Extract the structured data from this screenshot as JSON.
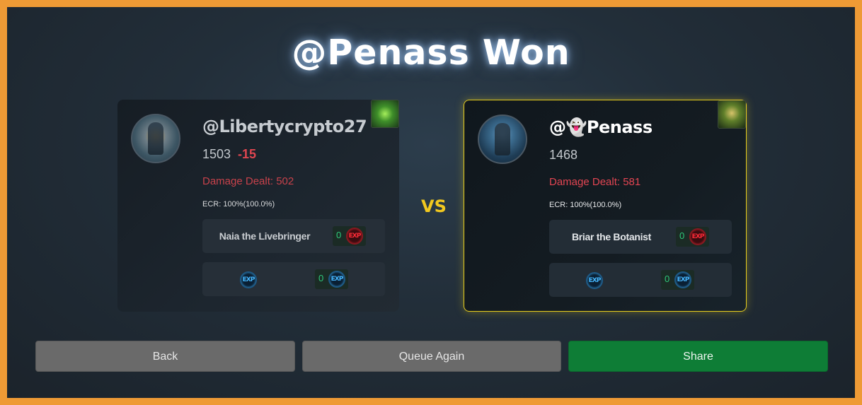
{
  "title": "@Penass Won",
  "vs_label": "VS",
  "players": [
    {
      "name": "@Libertycrypto27",
      "rating": "1503",
      "rating_delta": "-15",
      "damage_label": "Damage Dealt: 502",
      "ecr_label": "ECR: 100%(100.0%)",
      "hero_name": "Naia the Livebringer",
      "hero_xp": "0",
      "hero_xp_icon": "exp-red-icon",
      "unit_xp_icon": "exp-blue-icon",
      "unit_xp": "0",
      "winner": false
    },
    {
      "name": "@👻Penass",
      "rating": "1468",
      "rating_delta": "",
      "damage_label": "Damage Dealt: 581",
      "ecr_label": "ECR: 100%(100.0%)",
      "hero_name": "Briar the Botanist",
      "hero_xp": "0",
      "hero_xp_icon": "exp-red-icon",
      "unit_xp_icon": "exp-blue-icon",
      "unit_xp": "0",
      "winner": true
    }
  ],
  "xp_icon_text": "EXP",
  "buttons": {
    "back": "Back",
    "queue_again": "Queue Again",
    "share": "Share"
  },
  "colors": {
    "page_border": "#ee9a35",
    "winner_border": "#e9cf1d",
    "vs": "#f2c81f",
    "damage": "#e24552",
    "share_button": "#0e7d36"
  }
}
